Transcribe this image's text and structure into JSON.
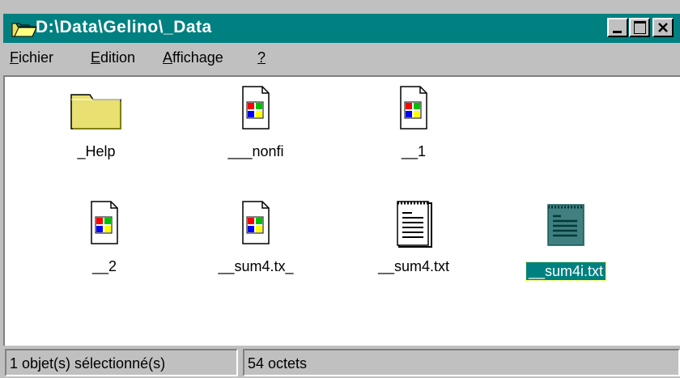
{
  "window": {
    "title": "D:\\Data\\Gelino\\_Data",
    "colors": {
      "titlebar": "#008080",
      "chrome": "#c0c0c0",
      "content": "#ffffff",
      "selection": "#008080"
    }
  },
  "controls": {
    "minimize": "_",
    "maximize": "□",
    "close": "×"
  },
  "menu": [
    {
      "accel": "F",
      "rest": "ichier"
    },
    {
      "accel": "E",
      "rest": "dition"
    },
    {
      "accel": "A",
      "rest": "ffichage"
    },
    {
      "accel": "?",
      "rest": ""
    }
  ],
  "files": [
    {
      "name": "_Help",
      "icon": "folder-icon",
      "selected": false
    },
    {
      "name": "___nonfi",
      "icon": "windows-file-icon",
      "selected": false
    },
    {
      "name": "__1",
      "icon": "windows-file-icon",
      "selected": false
    },
    {
      "name": "__2",
      "icon": "windows-file-icon",
      "selected": false
    },
    {
      "name": "__sum4.tx_",
      "icon": "windows-file-icon",
      "selected": false
    },
    {
      "name": "__sum4.txt",
      "icon": "text-document-icon",
      "selected": false
    },
    {
      "name": "__sum4i.txt",
      "icon": "text-document-icon",
      "selected": true
    }
  ],
  "status": {
    "selection": "1 objet(s) sélectionné(s)",
    "size": "54 octets"
  }
}
